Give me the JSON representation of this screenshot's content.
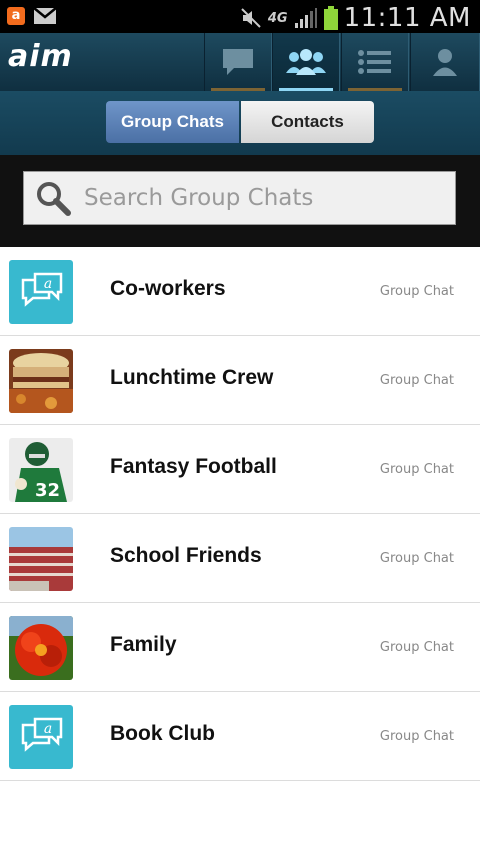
{
  "status_bar": {
    "network": "4G",
    "time": "11:11 AM",
    "icons": [
      "app-notification-icon",
      "gmail-icon",
      "mute-icon",
      "signal-icon",
      "battery-icon"
    ]
  },
  "app_bar": {
    "logo": "aim",
    "tabs": [
      {
        "name": "chats",
        "icon": "chat-bubble-icon",
        "active": false
      },
      {
        "name": "group-chats",
        "icon": "group-icon",
        "active": true
      },
      {
        "name": "buddy-list",
        "icon": "list-icon",
        "active": false
      },
      {
        "name": "profile",
        "icon": "person-icon",
        "active": false
      }
    ]
  },
  "segments": {
    "group_chats_label": "Group Chats",
    "contacts_label": "Contacts",
    "selected": "Group Chats"
  },
  "search": {
    "placeholder": "Search Group Chats"
  },
  "list": {
    "items": [
      {
        "name": "Co-workers",
        "type": "Group Chat",
        "avatar": "aim-chat-icon"
      },
      {
        "name": "Lunchtime Crew",
        "type": "Group Chat",
        "avatar": "sandwich-photo"
      },
      {
        "name": "Fantasy Football",
        "type": "Group Chat",
        "avatar": "football-player-photo"
      },
      {
        "name": "School Friends",
        "type": "Group Chat",
        "avatar": "stadium-photo"
      },
      {
        "name": "Family",
        "type": "Group Chat",
        "avatar": "red-flower-photo"
      },
      {
        "name": "Book Club",
        "type": "Group Chat",
        "avatar": "aim-chat-icon"
      }
    ]
  },
  "colors": {
    "app_bar": "#1e4a5f",
    "segment_active": "#5a80b6",
    "accent_teal": "#38b9cf"
  }
}
